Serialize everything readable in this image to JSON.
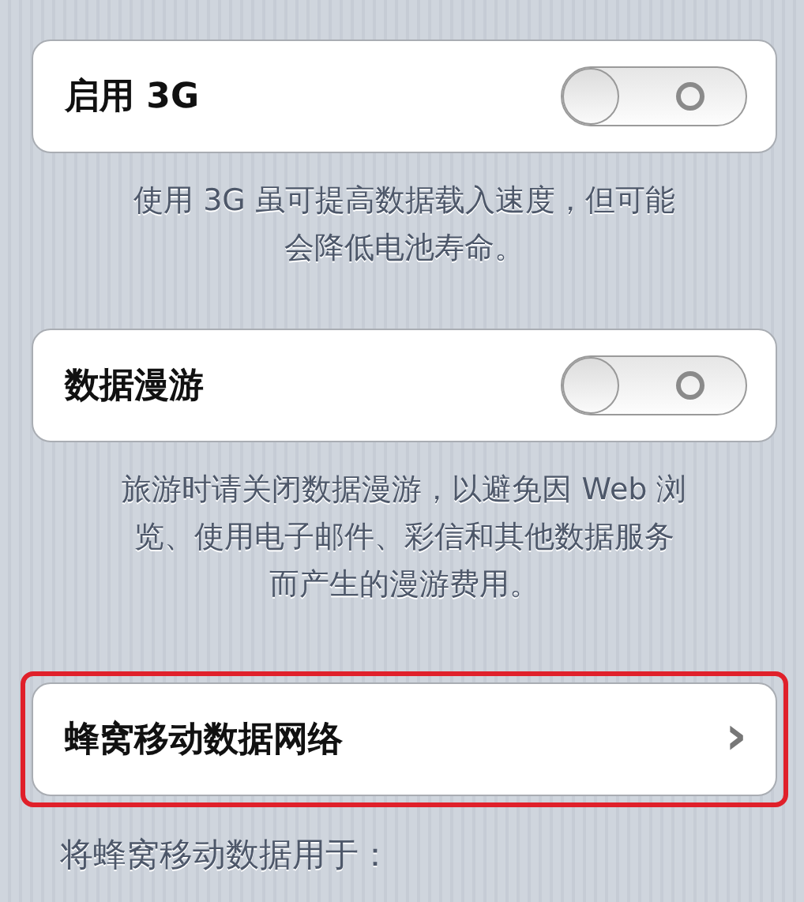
{
  "sections": [
    {
      "kind": "toggle",
      "label": "启用 3G",
      "on": false,
      "highlighted": false,
      "footer_lines": [
        "使用 3G 虽可提高数据载入速度，但可能",
        "会降低电池寿命。"
      ]
    },
    {
      "kind": "toggle",
      "label": "数据漫游",
      "on": false,
      "highlighted": false,
      "footer_lines": [
        "旅游时请关闭数据漫游，以避免因 Web 浏",
        "览、使用电子邮件、彩信和其他数据服务",
        "而产生的漫游费用。"
      ]
    },
    {
      "kind": "link",
      "label": "蜂窝移动数据网络",
      "highlighted": true,
      "chevron": "›"
    }
  ],
  "group_header": "将蜂窝移动数据用于："
}
